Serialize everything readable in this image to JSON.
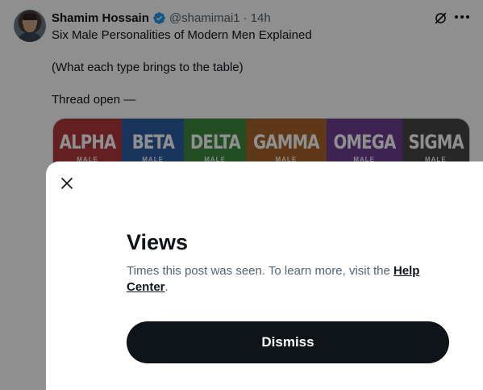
{
  "tweet": {
    "author_name": "Shamim Hossain",
    "handle": "@shamimai1",
    "separator": "·",
    "time": "14h",
    "lines": [
      "Six Male Personalities of Modern Men Explained",
      "(What each type brings to the table)",
      "Thread open —"
    ],
    "media_cards": [
      {
        "name": "ALPHA",
        "sub": "MALE",
        "color": "#b23a3a"
      },
      {
        "name": "BETA",
        "sub": "MALE",
        "color": "#2f5fa6"
      },
      {
        "name": "DELTA",
        "sub": "MALE",
        "color": "#3d8a3f"
      },
      {
        "name": "GAMMA",
        "sub": "MALE",
        "color": "#a9652a"
      },
      {
        "name": "OMEGA",
        "sub": "MALE",
        "color": "#6d3e93"
      },
      {
        "name": "SIGMA",
        "sub": "MALE",
        "color": "#474747"
      }
    ],
    "icons": {
      "verified": "verified-badge-icon",
      "grok": "grok-icon",
      "more": "more-icon"
    }
  },
  "modal": {
    "title": "Views",
    "description_prefix": "Times this post was seen. To learn more, visit the ",
    "link_text": "Help Center",
    "description_suffix": ".",
    "dismiss_label": "Dismiss",
    "close_icon": "close-icon"
  },
  "colors": {
    "text_primary": "#0f1419",
    "text_secondary": "#536471",
    "verified_blue": "#1d9bf0",
    "button_bg": "#0f1419"
  }
}
